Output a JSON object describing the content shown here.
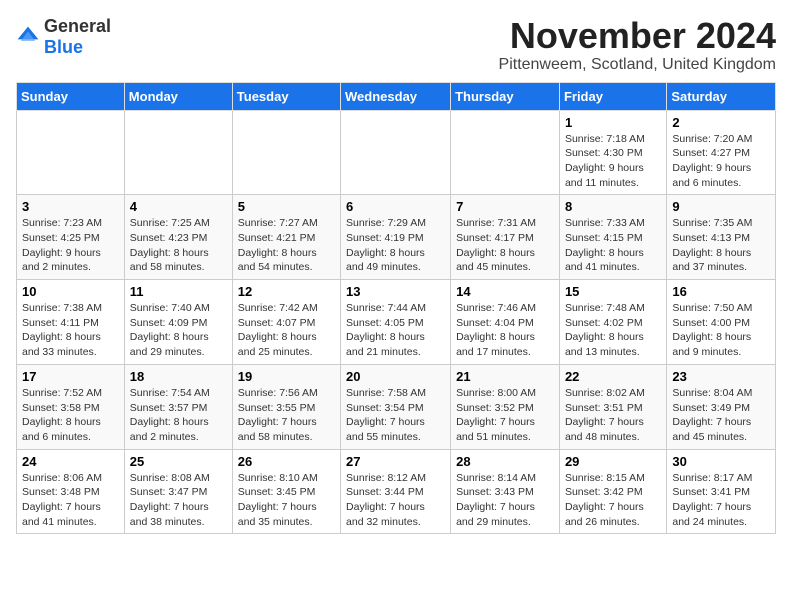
{
  "logo": {
    "text_general": "General",
    "text_blue": "Blue"
  },
  "header": {
    "month": "November 2024",
    "location": "Pittenweem, Scotland, United Kingdom"
  },
  "days_of_week": [
    "Sunday",
    "Monday",
    "Tuesday",
    "Wednesday",
    "Thursday",
    "Friday",
    "Saturday"
  ],
  "weeks": [
    [
      {
        "day": "",
        "info": ""
      },
      {
        "day": "",
        "info": ""
      },
      {
        "day": "",
        "info": ""
      },
      {
        "day": "",
        "info": ""
      },
      {
        "day": "",
        "info": ""
      },
      {
        "day": "1",
        "info": "Sunrise: 7:18 AM\nSunset: 4:30 PM\nDaylight: 9 hours and 11 minutes."
      },
      {
        "day": "2",
        "info": "Sunrise: 7:20 AM\nSunset: 4:27 PM\nDaylight: 9 hours and 6 minutes."
      }
    ],
    [
      {
        "day": "3",
        "info": "Sunrise: 7:23 AM\nSunset: 4:25 PM\nDaylight: 9 hours and 2 minutes."
      },
      {
        "day": "4",
        "info": "Sunrise: 7:25 AM\nSunset: 4:23 PM\nDaylight: 8 hours and 58 minutes."
      },
      {
        "day": "5",
        "info": "Sunrise: 7:27 AM\nSunset: 4:21 PM\nDaylight: 8 hours and 54 minutes."
      },
      {
        "day": "6",
        "info": "Sunrise: 7:29 AM\nSunset: 4:19 PM\nDaylight: 8 hours and 49 minutes."
      },
      {
        "day": "7",
        "info": "Sunrise: 7:31 AM\nSunset: 4:17 PM\nDaylight: 8 hours and 45 minutes."
      },
      {
        "day": "8",
        "info": "Sunrise: 7:33 AM\nSunset: 4:15 PM\nDaylight: 8 hours and 41 minutes."
      },
      {
        "day": "9",
        "info": "Sunrise: 7:35 AM\nSunset: 4:13 PM\nDaylight: 8 hours and 37 minutes."
      }
    ],
    [
      {
        "day": "10",
        "info": "Sunrise: 7:38 AM\nSunset: 4:11 PM\nDaylight: 8 hours and 33 minutes."
      },
      {
        "day": "11",
        "info": "Sunrise: 7:40 AM\nSunset: 4:09 PM\nDaylight: 8 hours and 29 minutes."
      },
      {
        "day": "12",
        "info": "Sunrise: 7:42 AM\nSunset: 4:07 PM\nDaylight: 8 hours and 25 minutes."
      },
      {
        "day": "13",
        "info": "Sunrise: 7:44 AM\nSunset: 4:05 PM\nDaylight: 8 hours and 21 minutes."
      },
      {
        "day": "14",
        "info": "Sunrise: 7:46 AM\nSunset: 4:04 PM\nDaylight: 8 hours and 17 minutes."
      },
      {
        "day": "15",
        "info": "Sunrise: 7:48 AM\nSunset: 4:02 PM\nDaylight: 8 hours and 13 minutes."
      },
      {
        "day": "16",
        "info": "Sunrise: 7:50 AM\nSunset: 4:00 PM\nDaylight: 8 hours and 9 minutes."
      }
    ],
    [
      {
        "day": "17",
        "info": "Sunrise: 7:52 AM\nSunset: 3:58 PM\nDaylight: 8 hours and 6 minutes."
      },
      {
        "day": "18",
        "info": "Sunrise: 7:54 AM\nSunset: 3:57 PM\nDaylight: 8 hours and 2 minutes."
      },
      {
        "day": "19",
        "info": "Sunrise: 7:56 AM\nSunset: 3:55 PM\nDaylight: 7 hours and 58 minutes."
      },
      {
        "day": "20",
        "info": "Sunrise: 7:58 AM\nSunset: 3:54 PM\nDaylight: 7 hours and 55 minutes."
      },
      {
        "day": "21",
        "info": "Sunrise: 8:00 AM\nSunset: 3:52 PM\nDaylight: 7 hours and 51 minutes."
      },
      {
        "day": "22",
        "info": "Sunrise: 8:02 AM\nSunset: 3:51 PM\nDaylight: 7 hours and 48 minutes."
      },
      {
        "day": "23",
        "info": "Sunrise: 8:04 AM\nSunset: 3:49 PM\nDaylight: 7 hours and 45 minutes."
      }
    ],
    [
      {
        "day": "24",
        "info": "Sunrise: 8:06 AM\nSunset: 3:48 PM\nDaylight: 7 hours and 41 minutes."
      },
      {
        "day": "25",
        "info": "Sunrise: 8:08 AM\nSunset: 3:47 PM\nDaylight: 7 hours and 38 minutes."
      },
      {
        "day": "26",
        "info": "Sunrise: 8:10 AM\nSunset: 3:45 PM\nDaylight: 7 hours and 35 minutes."
      },
      {
        "day": "27",
        "info": "Sunrise: 8:12 AM\nSunset: 3:44 PM\nDaylight: 7 hours and 32 minutes."
      },
      {
        "day": "28",
        "info": "Sunrise: 8:14 AM\nSunset: 3:43 PM\nDaylight: 7 hours and 29 minutes."
      },
      {
        "day": "29",
        "info": "Sunrise: 8:15 AM\nSunset: 3:42 PM\nDaylight: 7 hours and 26 minutes."
      },
      {
        "day": "30",
        "info": "Sunrise: 8:17 AM\nSunset: 3:41 PM\nDaylight: 7 hours and 24 minutes."
      }
    ]
  ]
}
